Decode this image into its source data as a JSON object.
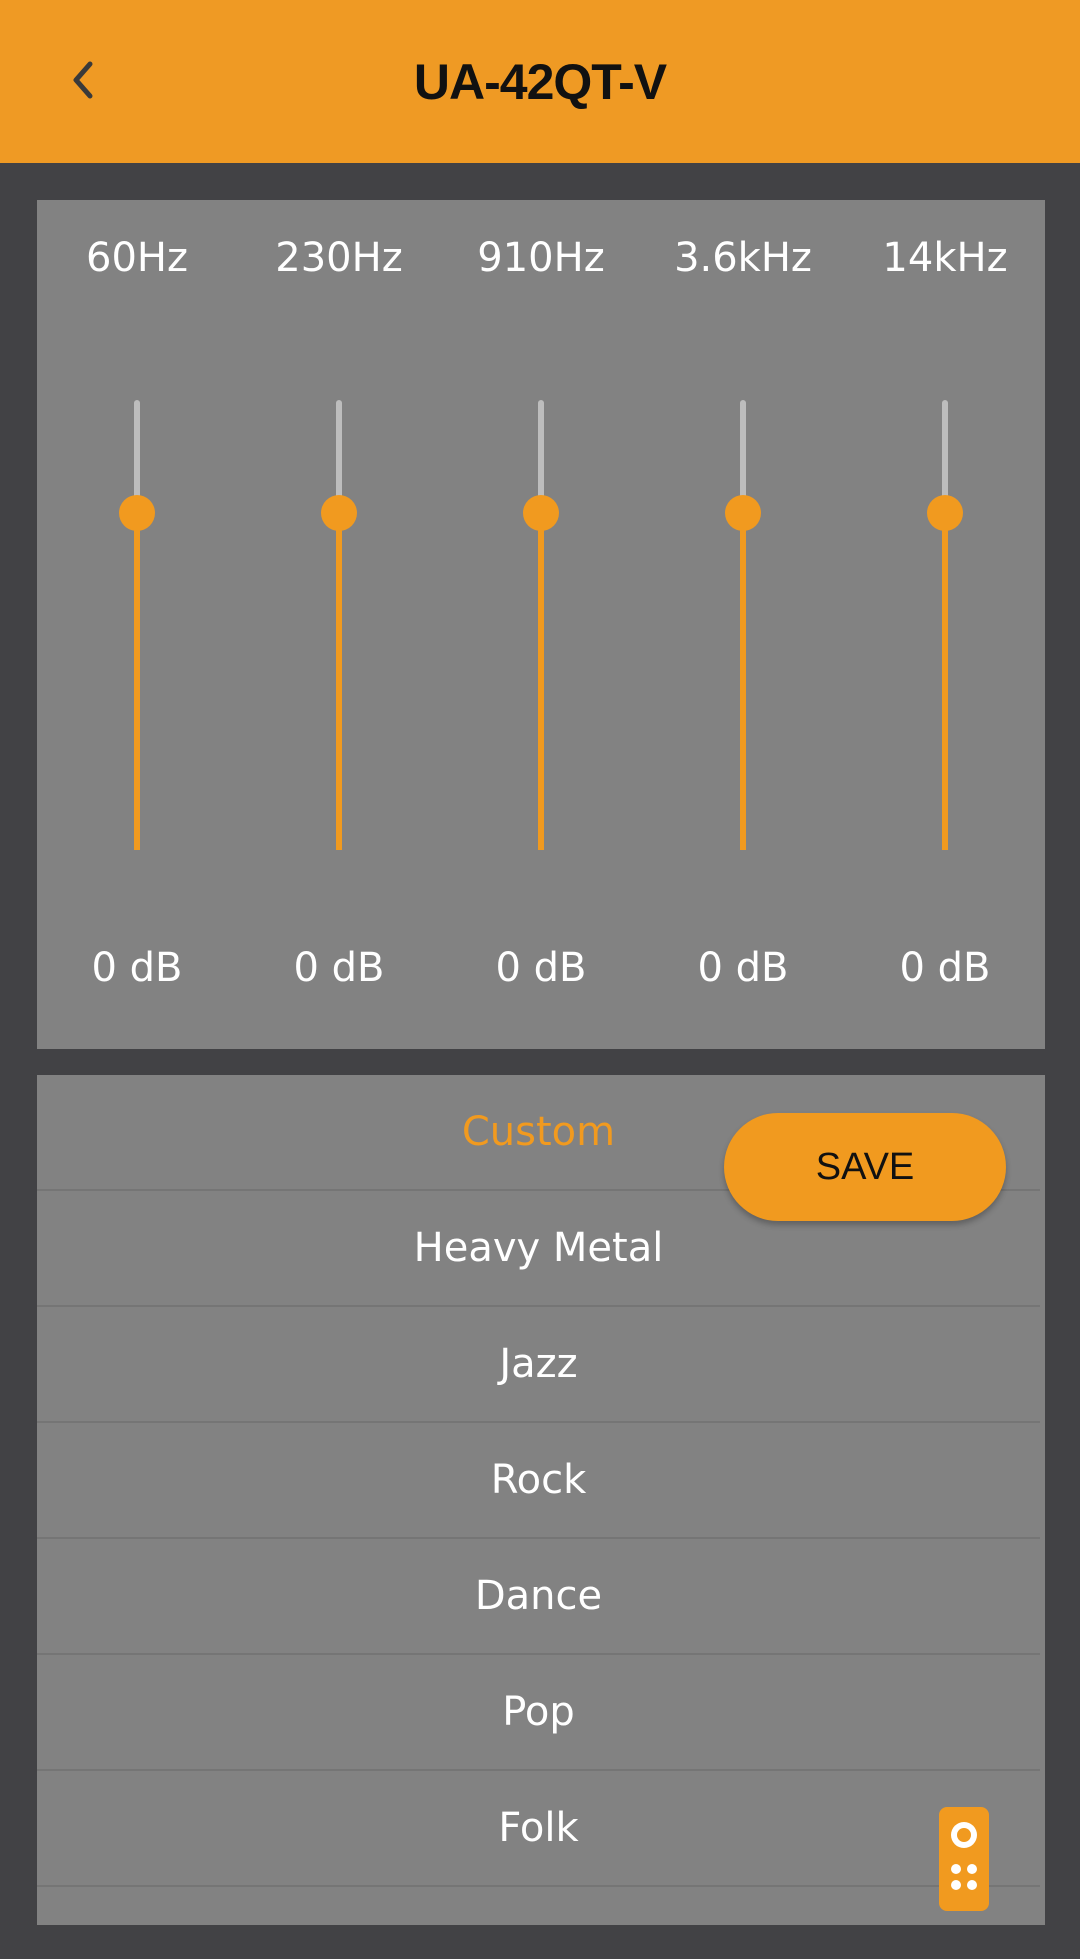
{
  "header": {
    "title": "UA-42QT-V",
    "back_icon": "chevron-left-icon",
    "bg_color": "#EF9A24"
  },
  "equalizer": {
    "accent_color": "#F19A1F",
    "bands": [
      {
        "frequency": "60Hz",
        "gain": "0 dB",
        "level": 0.75
      },
      {
        "frequency": "230Hz",
        "gain": "0 dB",
        "level": 0.75
      },
      {
        "frequency": "910Hz",
        "gain": "0 dB",
        "level": 0.75
      },
      {
        "frequency": "3.6kHz",
        "gain": "0 dB",
        "level": 0.75
      },
      {
        "frequency": "14kHz",
        "gain": "0 dB",
        "level": 0.75
      }
    ]
  },
  "presets": {
    "selected": "Custom",
    "items": [
      "Custom",
      "Heavy Metal",
      "Jazz",
      "Rock",
      "Dance",
      "Pop",
      "Folk"
    ]
  },
  "save_button": {
    "label": "SAVE"
  },
  "floating": {
    "remote_icon": "remote-control-icon"
  }
}
